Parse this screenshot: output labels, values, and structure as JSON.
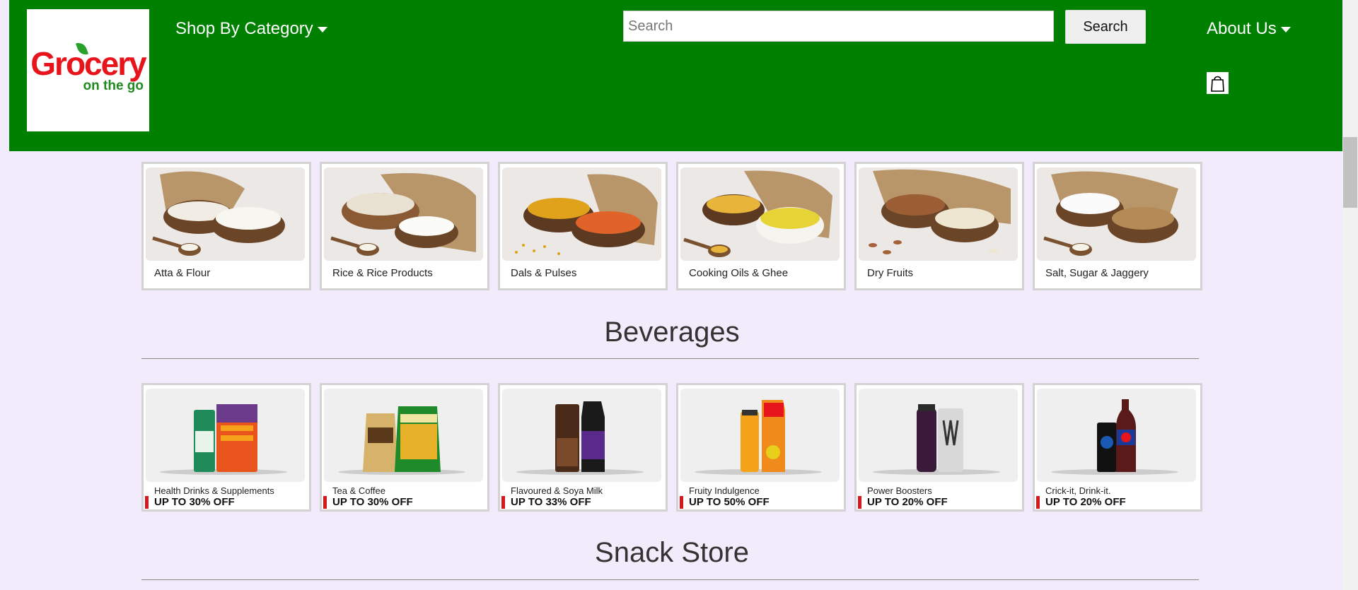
{
  "header": {
    "logo": {
      "line1": "Grocery",
      "line2": "on the go"
    },
    "nav_category": "Shop By Category",
    "search": {
      "placeholder": "Search",
      "button": "Search"
    },
    "about": "About Us",
    "icons": {
      "caret": "caret-down-icon",
      "cart": "shopping-bag-icon"
    }
  },
  "staples": [
    {
      "label": "Atta & Flour"
    },
    {
      "label": "Rice & Rice Products"
    },
    {
      "label": "Dals & Pulses"
    },
    {
      "label": "Cooking Oils & Ghee"
    },
    {
      "label": "Dry Fruits"
    },
    {
      "label": "Salt, Sugar & Jaggery"
    }
  ],
  "beverages": {
    "title": "Beverages",
    "items": [
      {
        "label": "Health Drinks & Supplements",
        "offer": "UP TO 30% OFF"
      },
      {
        "label": "Tea & Coffee",
        "offer": "UP TO 30% OFF"
      },
      {
        "label": "Flavoured & Soya Milk",
        "offer": "UP TO 33% OFF"
      },
      {
        "label": "Fruity Indulgence",
        "offer": "UP TO 50% OFF"
      },
      {
        "label": "Power Boosters",
        "offer": "UP TO 20% OFF"
      },
      {
        "label": "Crick-it, Drink-it.",
        "offer": "UP TO 20% OFF"
      }
    ]
  },
  "snacks": {
    "title": "Snack Store"
  },
  "colors": {
    "header_bg": "#008000",
    "page_bg": "#f1ebfb",
    "logo_red": "#e8141c",
    "offer_bar": "#d6171d"
  }
}
